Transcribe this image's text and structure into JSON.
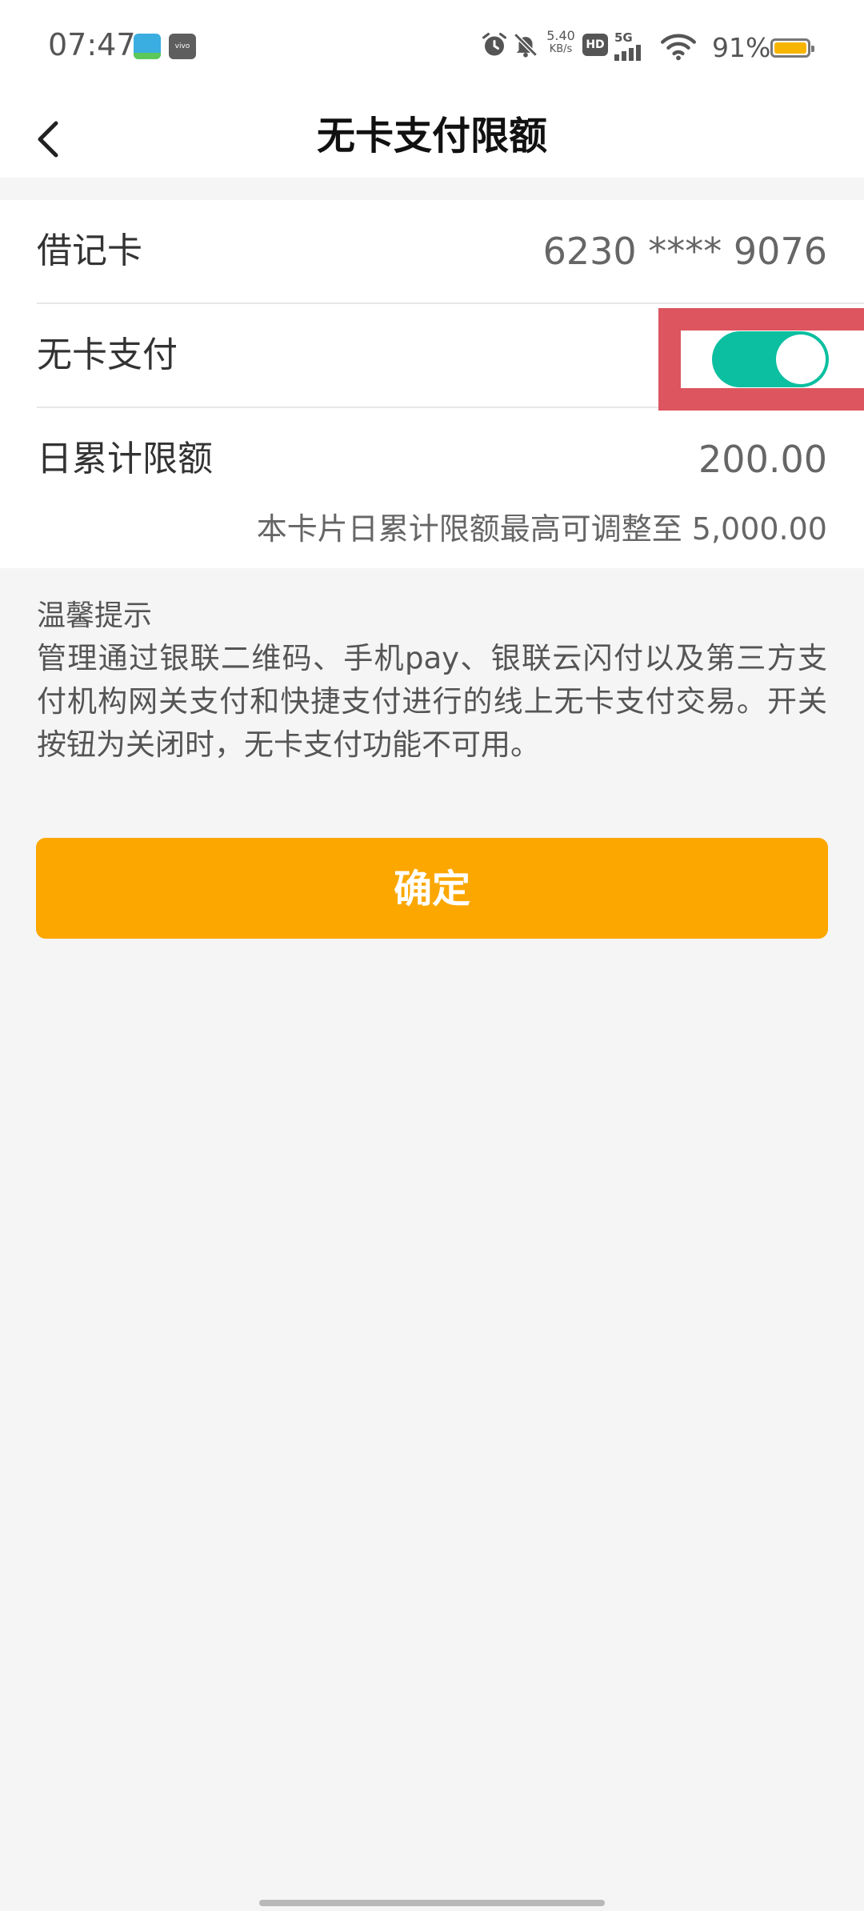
{
  "status_bar": {
    "time": "07:47",
    "app_icon_2_text": "vivo",
    "net_speed_value": "5.40",
    "net_speed_unit": "KB/s",
    "hd_badge": "HD",
    "network_type": "5G",
    "battery_percent": "91%",
    "icons": [
      "wifi-settings-app-icon",
      "vivo-app-icon",
      "alarm-icon",
      "mute-icon",
      "hd-icon",
      "signal-icon",
      "wifi-icon",
      "battery-icon"
    ],
    "battery_color": "#f7b500"
  },
  "nav": {
    "title": "无卡支付限额",
    "back_icon": "chevron-left-icon"
  },
  "card": {
    "debit_label": "借记卡",
    "debit_value": "6230 **** 9076",
    "cardless_label": "无卡支付",
    "cardless_enabled": true,
    "daily_label": "日累计限额",
    "daily_value": "200.00",
    "limit_hint": "本卡片日累计限额最高可调整至 5,000.00"
  },
  "tips": {
    "title": "温馨提示",
    "body": "管理通过银联二维码、手机pay、银联云闪付以及第三方支付机构网关支付和快捷支付进行的线上无卡支付交易。开关按钮为关闭时，无卡支付功能不可用。"
  },
  "confirm_label": "确定",
  "colors": {
    "accent": "#fba700",
    "toggle_on": "#0cbfa0",
    "highlight": "#dc555f"
  }
}
